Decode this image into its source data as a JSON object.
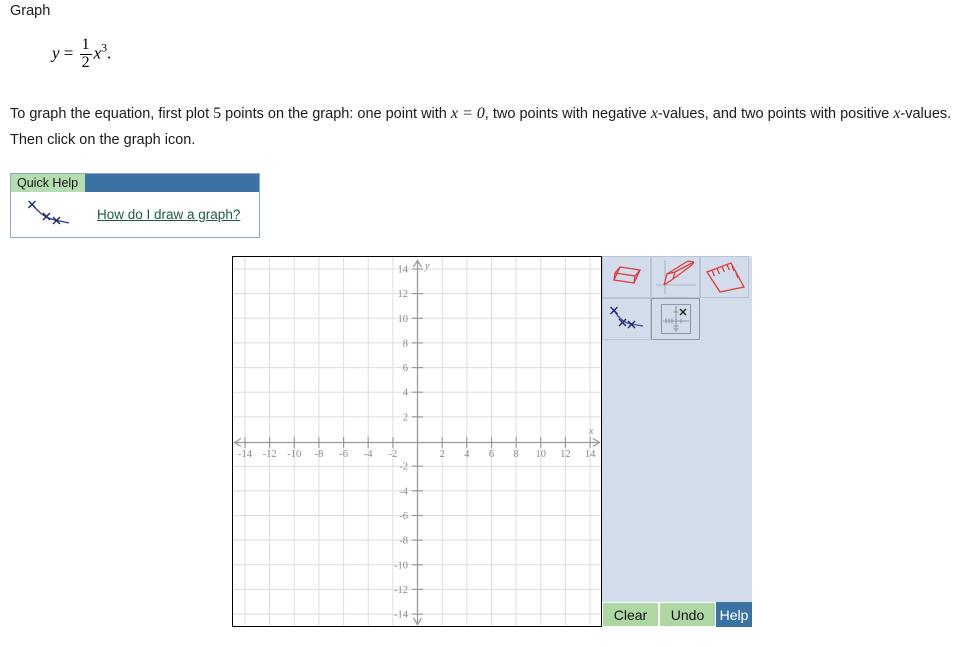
{
  "heading": "Graph",
  "equation": {
    "lhs": "y",
    "equals": "=",
    "numerator": "1",
    "denominator": "2",
    "variable": "x",
    "exponent": "3",
    "period": "."
  },
  "instructions": {
    "part1": "To graph the equation, first plot ",
    "count": "5",
    "part2": " points on the graph: one point with ",
    "cond": "x = 0",
    "part3": ", two points with negative ",
    "xvar1": "x",
    "part4": "-values, and two points with positive ",
    "xvar2": "x",
    "part5": "-values. Then click on the graph icon."
  },
  "quick_help": {
    "tab_label": "Quick Help",
    "link_label": "How do I draw a graph?",
    "icon_name": "curve-with-points-icon"
  },
  "toolbar": {
    "tools": [
      {
        "name": "eraser-tool",
        "label": "Eraser",
        "selected": false
      },
      {
        "name": "pencil-tool",
        "label": "Pencil",
        "selected": false
      },
      {
        "name": "ruler-tool",
        "label": "Ruler",
        "selected": false
      },
      {
        "name": "curve-tool",
        "label": "Draw curve",
        "selected": false
      },
      {
        "name": "plot-point-tool",
        "label": "Plot point",
        "selected": true
      }
    ]
  },
  "buttons": {
    "clear": "Clear",
    "undo": "Undo",
    "help": "Help"
  },
  "colors": {
    "accent_blue": "#3b72a4",
    "tab_green": "#b6ddb0",
    "button_green": "#aed7a4",
    "panel_bg": "#d3dcea",
    "tool_icon_red": "#e03b3b",
    "curve_blue": "#4a4fbf",
    "grid": "#d8d8d8",
    "axis": "#9a9a9a",
    "link": "#1f5c3d"
  },
  "chart_data": {
    "type": "line",
    "title": "",
    "xlabel": "x",
    "ylabel": "y",
    "xlim": [
      -15,
      15
    ],
    "ylim": [
      -15,
      15
    ],
    "xticks": [
      -14,
      -12,
      -10,
      -8,
      -6,
      -4,
      -2,
      2,
      4,
      6,
      8,
      10,
      12,
      14
    ],
    "yticks": [
      14,
      12,
      10,
      8,
      6,
      4,
      2,
      -2,
      -4,
      -6,
      -8,
      -10,
      -12,
      -14
    ],
    "xtick_labels": [
      "-14",
      "-12",
      "-10",
      "-8",
      "-6",
      "-4",
      "-2",
      "2",
      "4",
      "6",
      "8",
      "10",
      "12",
      "14"
    ],
    "ytick_labels": [
      "14",
      "12",
      "10",
      "8",
      "6",
      "4",
      "2",
      "-2",
      "-4",
      "-6",
      "-8",
      "-10",
      "-12",
      "-14"
    ],
    "grid": true,
    "grid_step": 2,
    "legend": "none",
    "series": [
      {
        "name": "plotted-points",
        "x": [],
        "y": []
      }
    ],
    "equation": "y = (1/2)x^3",
    "annotations": []
  }
}
